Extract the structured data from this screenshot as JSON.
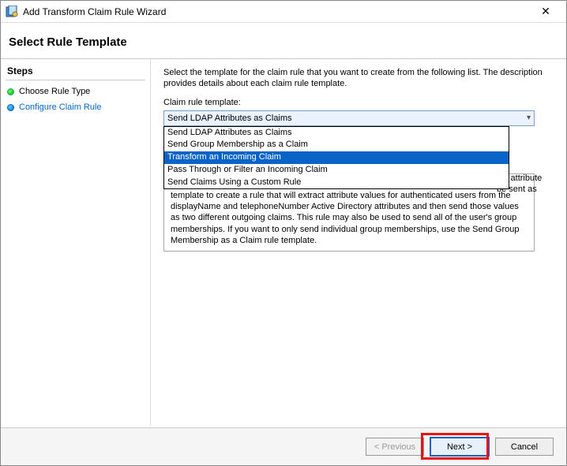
{
  "window": {
    "title": "Add Transform Claim Rule Wizard"
  },
  "header": "Select Rule Template",
  "sidebar": {
    "title": "Steps",
    "items": [
      {
        "label": "Choose Rule Type"
      },
      {
        "label": "Configure Claim Rule"
      }
    ]
  },
  "main": {
    "instruction": "Select the template for the claim rule that you want to create from the following list. The description provides details about each claim rule template.",
    "combo_label": "Claim rule template:",
    "combo_selected": "Send LDAP Attributes as Claims",
    "combo_options": [
      "Send LDAP Attributes as Claims",
      "Send Group Membership as a Claim",
      "Transform an Incoming Claim",
      "Pass Through or Filter an Incoming Claim",
      "Send Claims Using a Custom Rule"
    ],
    "highlighted_index": 2,
    "desc_leak_a": "AP attribute",
    "desc_leak_b": "be sent as",
    "desc_visible": "multiple claims from a single rule using this rule type. For example, you can use this rule template to create a rule that will extract attribute values for authenticated users from the displayName and telephoneNumber Active Directory attributes and then send those values as two different outgoing claims. This rule may also be used to send all of the user's group memberships. If you want to only send individual group memberships, use the Send Group Membership as a Claim rule template."
  },
  "footer": {
    "previous": "< Previous",
    "next": "Next >",
    "cancel": "Cancel"
  }
}
